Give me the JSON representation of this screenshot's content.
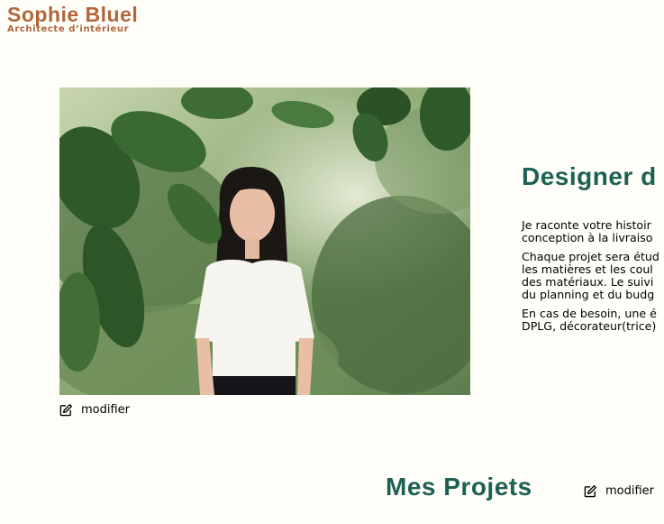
{
  "header": {
    "brand": "Sophie Bluel",
    "tagline": "Architecte d’intérieur"
  },
  "intro": {
    "edit_label": "modifier",
    "title": "Designer d",
    "paragraphs": [
      [
        "Je raconte votre histoir",
        "conception à la livraiso"
      ],
      [
        "Chaque projet sera étud",
        "les matières et les coul",
        "des matériaux. Le suivi",
        "du planning et du budg"
      ],
      [
        "En cas de besoin, une é",
        "DPLG, décorateur(trice)"
      ]
    ]
  },
  "projects": {
    "title": "Mes Projets",
    "edit_label": "modifier"
  },
  "icons": {
    "edit": "pen-square-icon"
  },
  "colors": {
    "brand": "#b1663c",
    "heading": "#1d6154",
    "background": "#fffef8"
  }
}
